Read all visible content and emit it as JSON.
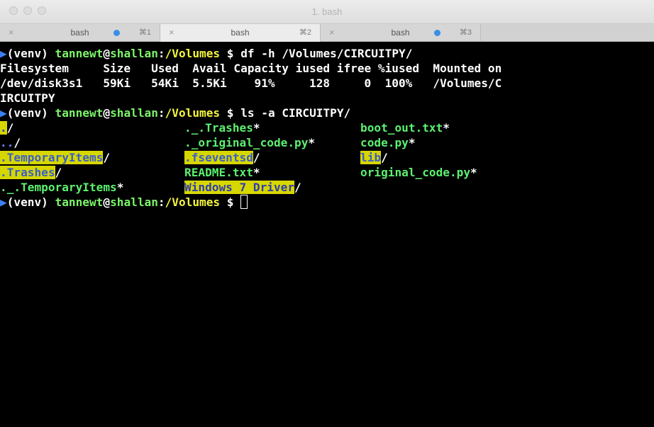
{
  "window": {
    "title": "1. bash"
  },
  "tabs": [
    {
      "label": "bash",
      "shortcut": "⌘1",
      "close": "×"
    },
    {
      "label": "bash",
      "shortcut": "⌘2",
      "close": "×"
    },
    {
      "label": "bash",
      "shortcut": "⌘3",
      "close": "×"
    }
  ],
  "prompt": {
    "venv": "(venv) ",
    "user": "tannewt",
    "at": "@",
    "host": "shallan",
    "colon": ":",
    "dir": "/Volumes",
    "sigil": " $ "
  },
  "commands": {
    "df": "df -h /Volumes/CIRCUITPY/",
    "ls": "ls -a CIRCUITPY/"
  },
  "df_output": {
    "header": "Filesystem     Size   Used  Avail Capacity iused ifree %iused  Mounted on",
    "row": "/dev/disk3s1   59Ki   54Ki  5.5Ki    91%     128     0  100%   /Volumes/C",
    "wrap": "IRCUITPY"
  },
  "ls_output": {
    "col1": [
      "./",
      "../",
      ".TemporaryItems/",
      ".Trashes/",
      "._.TemporaryItems*"
    ],
    "col2": [
      "._.Trashes*",
      "._original_code.py*",
      ".fseventsd/",
      "README.txt*",
      "Windows 7 Driver/"
    ],
    "col3": [
      "boot_out.txt*",
      "code.py*",
      "lib/",
      "original_code.py*"
    ]
  }
}
